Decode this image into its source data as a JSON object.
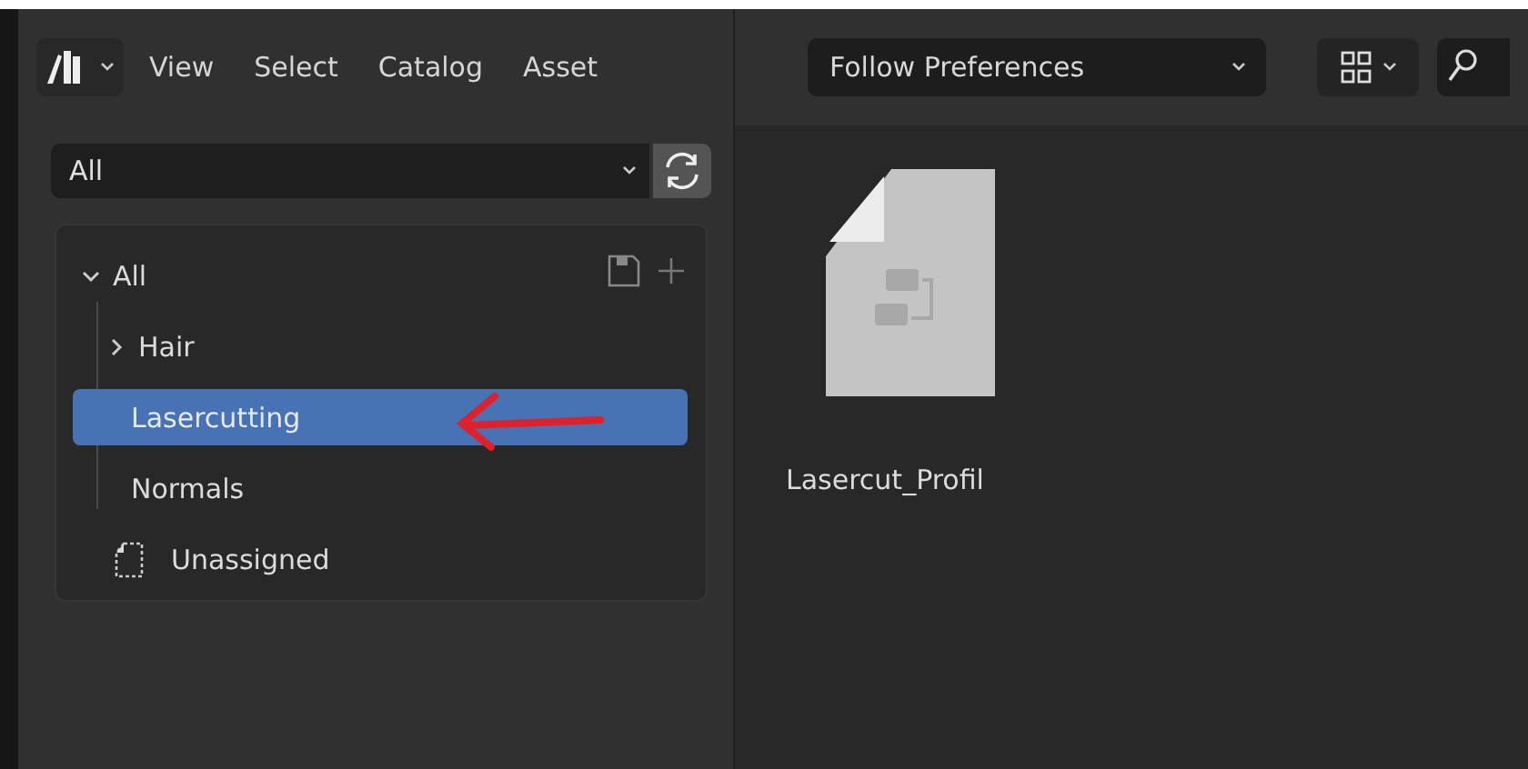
{
  "header": {
    "menus": [
      "View",
      "Select",
      "Catalog",
      "Asset"
    ],
    "import_method": "Follow Preferences"
  },
  "catalog_filter": {
    "value": "All"
  },
  "catalog_tree": [
    {
      "label": "All",
      "expanded": true,
      "selected": false,
      "children": [
        {
          "label": "Hair",
          "expanded": false,
          "selected": false
        },
        {
          "label": "Lasercutting",
          "selected": true
        },
        {
          "label": "Normals",
          "selected": false
        }
      ]
    },
    {
      "label": "Unassigned",
      "kind": "unassigned",
      "selected": false
    }
  ],
  "assets": [
    {
      "name": "Lasercut_Profil"
    }
  ]
}
